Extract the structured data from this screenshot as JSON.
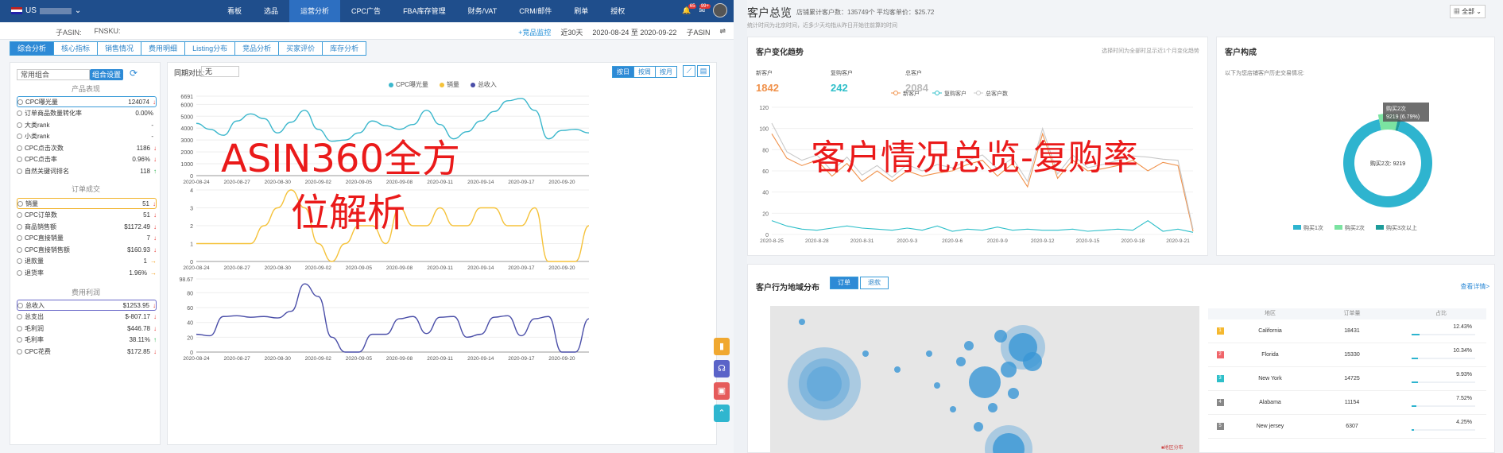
{
  "left": {
    "nav": {
      "store": "US",
      "items": [
        "看板",
        "选品",
        "运营分析",
        "CPC广告",
        "FBA库存管理",
        "财务/VAT",
        "CRM/邮件",
        "刷单",
        "授权"
      ],
      "active_index": 2,
      "badge_bell": "65",
      "badge_msg": "99+"
    },
    "subbar": {
      "asin": "子ASIN:",
      "fnsku": "FNSKU:",
      "link": "+竞品监控",
      "range": "近30天",
      "dates": "2020-08-24 至 2020-09-22",
      "mode": "子ASIN",
      "compare": "⇌"
    },
    "tabs": [
      "综合分析",
      "核心指标",
      "销售情况",
      "费用明细",
      "Listing分布",
      "竞品分析",
      "买家评价",
      "库存分析"
    ],
    "active_tab": 0,
    "sidebar": {
      "select": "常用组合",
      "btn": "组合设置",
      "sec1": "产品表现",
      "sec2": "订单成交",
      "sec3": "费用利润",
      "group1": [
        {
          "label": "CPC曝光量",
          "value": "124074",
          "arrow": "down"
        },
        {
          "label": "订单商品数量转化率",
          "value": "0.00%",
          "arrow": ""
        },
        {
          "label": "大类rank",
          "value": "-",
          "arrow": ""
        },
        {
          "label": "小类rank",
          "value": "-",
          "arrow": ""
        },
        {
          "label": "CPC点击次数",
          "value": "1186",
          "arrow": "down"
        },
        {
          "label": "CPC点击率",
          "value": "0.96%",
          "arrow": "down"
        },
        {
          "label": "自然关键词排名",
          "value": "118",
          "arrow": "up"
        }
      ],
      "group2": [
        {
          "label": "销量",
          "value": "51",
          "arrow": "down"
        },
        {
          "label": "CPC订单数",
          "value": "51",
          "arrow": "down"
        },
        {
          "label": "商品销售额",
          "value": "$1172.49",
          "arrow": "down"
        },
        {
          "label": "CPC直接销量",
          "value": "7",
          "arrow": "down"
        },
        {
          "label": "CPC直接销售额",
          "value": "$160.93",
          "arrow": "down"
        },
        {
          "label": "退款量",
          "value": "1",
          "arrow": "flat"
        },
        {
          "label": "退货率",
          "value": "1.96%",
          "arrow": "flat"
        }
      ],
      "group3": [
        {
          "label": "总收入",
          "value": "$1253.95",
          "arrow": "down"
        },
        {
          "label": "总支出",
          "value": "$-807.17",
          "arrow": "down"
        },
        {
          "label": "毛利润",
          "value": "$446.78",
          "arrow": "down"
        },
        {
          "label": "毛利率",
          "value": "38.11%",
          "arrow": "up"
        },
        {
          "label": "CPC花费",
          "value": "$172.85",
          "arrow": "down"
        }
      ]
    },
    "main": {
      "compare_label": "同期对比:",
      "compare_value": "无",
      "gran": [
        "按日",
        "按周",
        "按月"
      ],
      "legend": [
        "CPC曝光量",
        "销量",
        "总收入"
      ]
    },
    "overlay1": "ASIN360全方",
    "overlay2": "位解析"
  },
  "chart_data": [
    {
      "type": "line",
      "title": "",
      "ylabel": "",
      "x": [
        "2020-08-24",
        "2020-08-25",
        "2020-08-26",
        "2020-08-27",
        "2020-08-28",
        "2020-08-29",
        "2020-08-30",
        "2020-08-31",
        "2020-09-01",
        "2020-09-02",
        "2020-09-03",
        "2020-09-04",
        "2020-09-05",
        "2020-09-06",
        "2020-09-07",
        "2020-09-08",
        "2020-09-09",
        "2020-09-10",
        "2020-09-11",
        "2020-09-12",
        "2020-09-13",
        "2020-09-14",
        "2020-09-15",
        "2020-09-16",
        "2020-09-17",
        "2020-09-18",
        "2020-09-19",
        "2020-09-20",
        "2020-09-21",
        "2020-09-22"
      ],
      "xticks": [
        "2020-08-24",
        "2020-08-27",
        "2020-08-30",
        "2020-09-02",
        "2020-09-05",
        "2020-09-08",
        "2020-09-11",
        "2020-09-14",
        "2020-09-17",
        "2020-09-20"
      ],
      "yticks": [
        0,
        1000,
        2000,
        3000,
        4000,
        5000,
        6000,
        6691
      ],
      "ylim": [
        0,
        6691
      ],
      "series": [
        {
          "name": "CPC曝光量",
          "color": "#3bb7cc",
          "values": [
            4400,
            3900,
            3400,
            4600,
            5200,
            4800,
            3600,
            4500,
            5500,
            3900,
            2900,
            3000,
            3600,
            4600,
            4200,
            3900,
            4300,
            5500,
            4300,
            3100,
            3700,
            4600,
            5400,
            6300,
            6500,
            5500,
            3100,
            3800,
            3900,
            3600
          ]
        }
      ]
    },
    {
      "type": "line",
      "title": "",
      "ylabel": "",
      "x": [
        "2020-08-24",
        "2020-08-25",
        "2020-08-26",
        "2020-08-27",
        "2020-08-28",
        "2020-08-29",
        "2020-08-30",
        "2020-08-31",
        "2020-09-01",
        "2020-09-02",
        "2020-09-03",
        "2020-09-04",
        "2020-09-05",
        "2020-09-06",
        "2020-09-07",
        "2020-09-08",
        "2020-09-09",
        "2020-09-10",
        "2020-09-11",
        "2020-09-12",
        "2020-09-13",
        "2020-09-14",
        "2020-09-15",
        "2020-09-16",
        "2020-09-17",
        "2020-09-18",
        "2020-09-19",
        "2020-09-20",
        "2020-09-21",
        "2020-09-22"
      ],
      "xticks": [
        "2020-08-24",
        "2020-08-27",
        "2020-08-30",
        "2020-09-02",
        "2020-09-05",
        "2020-09-08",
        "2020-09-11",
        "2020-09-14",
        "2020-09-17",
        "2020-09-20"
      ],
      "yticks": [
        0,
        1,
        2,
        3,
        4
      ],
      "ylim": [
        0,
        4
      ],
      "series": [
        {
          "name": "销量",
          "color": "#f5c23a",
          "values": [
            1,
            1,
            1,
            1,
            1,
            2,
            3,
            4,
            3,
            1,
            0,
            1,
            2,
            2,
            1,
            3,
            2,
            2,
            3,
            2,
            2,
            3,
            3,
            2,
            2,
            3,
            0,
            0,
            0,
            2
          ]
        }
      ]
    },
    {
      "type": "line",
      "title": "",
      "ylabel": "",
      "x": [
        "2020-08-24",
        "2020-08-25",
        "2020-08-26",
        "2020-08-27",
        "2020-08-28",
        "2020-08-29",
        "2020-08-30",
        "2020-08-31",
        "2020-09-01",
        "2020-09-02",
        "2020-09-03",
        "2020-09-04",
        "2020-09-05",
        "2020-09-06",
        "2020-09-07",
        "2020-09-08",
        "2020-09-09",
        "2020-09-10",
        "2020-09-11",
        "2020-09-12",
        "2020-09-13",
        "2020-09-14",
        "2020-09-15",
        "2020-09-16",
        "2020-09-17",
        "2020-09-18",
        "2020-09-19",
        "2020-09-20",
        "2020-09-21",
        "2020-09-22"
      ],
      "xticks": [
        "2020-08-24",
        "2020-08-27",
        "2020-08-30",
        "2020-09-02",
        "2020-09-05",
        "2020-09-08",
        "2020-09-11",
        "2020-09-14",
        "2020-09-17",
        "2020-09-20"
      ],
      "yticks": [
        0,
        20,
        40,
        60,
        80,
        98.67
      ],
      "ylim": [
        0,
        98.67
      ],
      "series": [
        {
          "name": "总收入",
          "color": "#4a4ea8",
          "values": [
            24,
            22,
            48,
            49,
            47,
            48,
            46,
            55,
            92,
            75,
            20,
            0,
            0,
            24,
            24,
            45,
            48,
            25,
            47,
            48,
            20,
            24,
            47,
            49,
            22,
            45,
            48,
            0,
            0,
            45
          ]
        }
      ]
    },
    {
      "type": "line",
      "title": "",
      "ylabel": "",
      "x": [
        "2020-8-25",
        "2020-8-26",
        "2020-8-27",
        "2020-8-28",
        "2020-8-29",
        "2020-8-30",
        "2020-8-31",
        "2020-9-1",
        "2020-9-2",
        "2020-9-3",
        "2020-9-4",
        "2020-9-5",
        "2020-9-6",
        "2020-9-7",
        "2020-9-8",
        "2020-9-9",
        "2020-9-10",
        "2020-9-11",
        "2020-9-12",
        "2020-9-13",
        "2020-9-14",
        "2020-9-15",
        "2020-9-16",
        "2020-9-17",
        "2020-9-18",
        "2020-9-19",
        "2020-9-20",
        "2020-9-21",
        "2020-9-22"
      ],
      "xticks": [
        "2020-8-25",
        "2020-8-28",
        "2020-8-31",
        "2020-9-3",
        "2020-9-6",
        "2020-9-9",
        "2020-9-12",
        "2020-9-15",
        "2020-9-18",
        "2020-9-21"
      ],
      "yticks": [
        0,
        20,
        40,
        60,
        80,
        100,
        120
      ],
      "ylim": [
        0,
        120
      ],
      "series": [
        {
          "name": "新客户",
          "color": "#f0914a",
          "values": [
            95,
            72,
            65,
            70,
            55,
            67,
            50,
            60,
            50,
            60,
            55,
            58,
            60,
            66,
            70,
            55,
            67,
            45,
            95,
            53,
            70,
            60,
            62,
            65,
            70,
            60,
            68,
            65,
            3
          ]
        },
        {
          "name": "复购客户",
          "color": "#2ebfc9",
          "values": [
            13,
            8,
            5,
            4,
            6,
            8,
            6,
            5,
            4,
            6,
            4,
            8,
            3,
            5,
            4,
            7,
            4,
            5,
            4,
            4,
            5,
            3,
            4,
            5,
            4,
            13,
            3,
            5,
            2
          ]
        },
        {
          "name": "总客户数",
          "color": "#c9c9c9",
          "values": [
            105,
            78,
            70,
            75,
            60,
            73,
            56,
            65,
            54,
            66,
            60,
            66,
            63,
            70,
            75,
            62,
            72,
            50,
            100,
            57,
            75,
            63,
            66,
            70,
            74,
            73,
            71,
            70,
            5
          ]
        }
      ]
    },
    {
      "type": "pie",
      "title": "",
      "categories": [
        "购买1次",
        "购买2次",
        "购买3次以上"
      ],
      "values": [
        125000,
        9219,
        1549
      ],
      "colors": [
        "#2eb4cf",
        "#7be3a1",
        "#1d9c9a"
      ],
      "tooltip_title": "购买2次",
      "tooltip_value": "9219 (6.79%)",
      "center_label": "购买2次: 9219"
    }
  ],
  "right": {
    "title": "客户总览",
    "sub1": "店铺累计客户数：135749个 平均客单价：$25.72",
    "sub2": "统计时间为北京时间，近多少天均指从昨日开始往前算的时间",
    "scope": "全部",
    "trend": {
      "title": "客户变化趋势",
      "note": "选择时间为全部时显示近1个月变化趋势",
      "stats": [
        {
          "label": "新客户",
          "value": "1842",
          "color": "#f0914a"
        },
        {
          "label": "复购客户",
          "value": "242",
          "color": "#2ebfc9"
        },
        {
          "label": "总客户",
          "value": "2084",
          "color": "#bbbbbb"
        }
      ]
    },
    "compose": {
      "title": "客户构成",
      "desc": "以下为您店铺客户历史交易情况:"
    },
    "geo": {
      "title": "客户行为地域分布",
      "tabs": [
        "订单",
        "退款"
      ],
      "more": "查看详情>",
      "legend_note": "■地区分布",
      "headers": [
        "地区",
        "订单量",
        "占比"
      ],
      "rows": [
        {
          "rank": "1",
          "region": "California",
          "orders": "18431",
          "pct": "12.43%",
          "frac": 0.1243,
          "color": "#f5b82e"
        },
        {
          "rank": "2",
          "region": "Florida",
          "orders": "15330",
          "pct": "10.34%",
          "frac": 0.1034,
          "color": "#f0656a"
        },
        {
          "rank": "3",
          "region": "New York",
          "orders": "14725",
          "pct": "9.93%",
          "frac": 0.0993,
          "color": "#2ebfc9"
        },
        {
          "rank": "4",
          "region": "Alabama",
          "orders": "11154",
          "pct": "7.52%",
          "frac": 0.0752,
          "color": "#888888"
        },
        {
          "rank": "5",
          "region": "New jersey",
          "orders": "6307",
          "pct": "4.25%",
          "frac": 0.0425,
          "color": "#888888"
        }
      ]
    },
    "overlay": "客户情况总览-复购率"
  }
}
